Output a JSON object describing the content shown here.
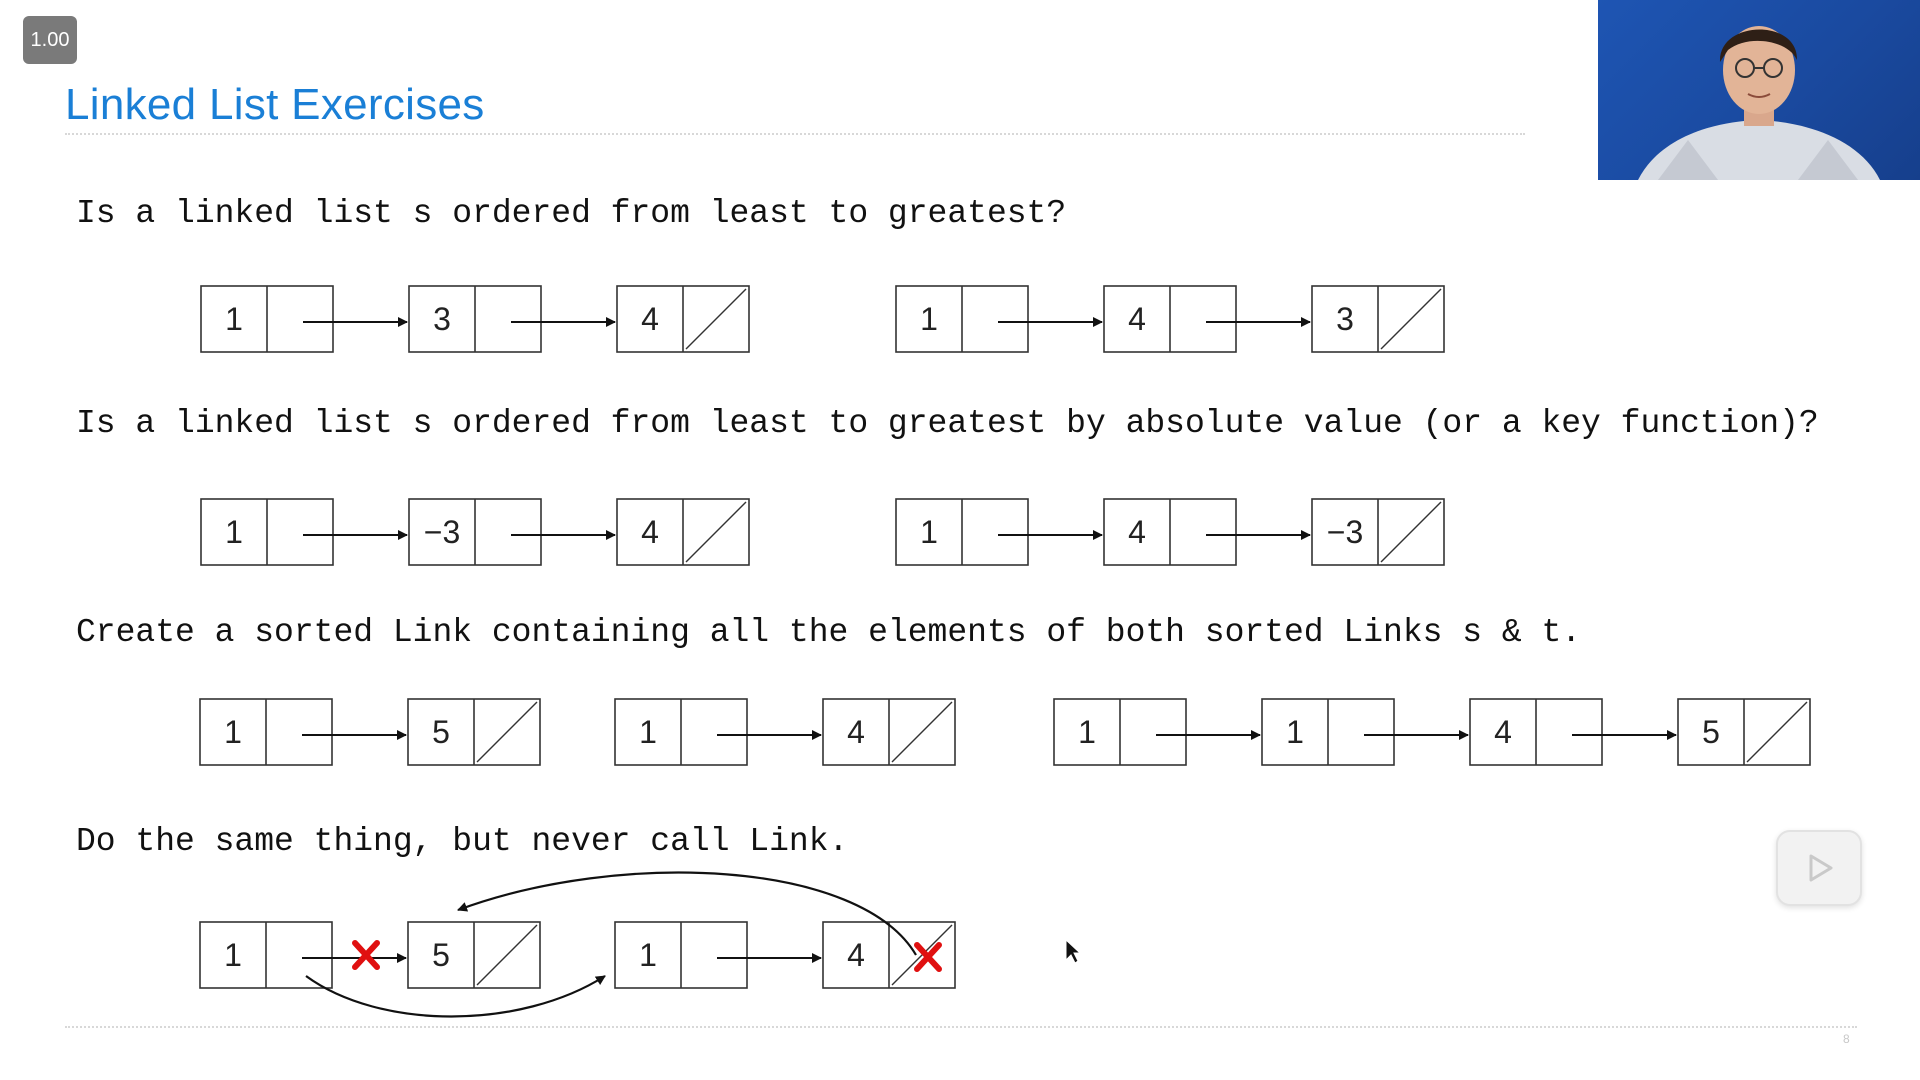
{
  "player": {
    "speed": "1.00",
    "page_number": "8"
  },
  "slide": {
    "title": "Linked List Exercises",
    "title_color": "#1a7fd6",
    "questions": [
      "Is a linked list s ordered from least to greatest?",
      "Is a linked list s ordered from least to greatest by absolute value (or a key function)?",
      "Create a sorted Link containing all the elements of both sorted Links s & t.",
      "Do the same thing, but never call Link."
    ]
  },
  "diagrams": {
    "row1": [
      [
        "1",
        "3",
        "4"
      ],
      [
        "1",
        "4",
        "3"
      ]
    ],
    "row2": [
      [
        "1",
        "−3",
        "4"
      ],
      [
        "1",
        "4",
        "−3"
      ]
    ],
    "row3": [
      [
        "1",
        "5"
      ],
      [
        "1",
        "4"
      ],
      [
        "1",
        "1",
        "4",
        "5"
      ]
    ],
    "row4": [
      [
        "1",
        "5"
      ],
      [
        "1",
        "4"
      ]
    ]
  },
  "colors": {
    "cross_mark": "#e01010",
    "box_stroke": "#333333",
    "webcam_background": "#1e55b3"
  },
  "icons": {
    "play": "play-icon",
    "cursor": "mouse-cursor-icon",
    "cross": "x-mark-icon"
  }
}
